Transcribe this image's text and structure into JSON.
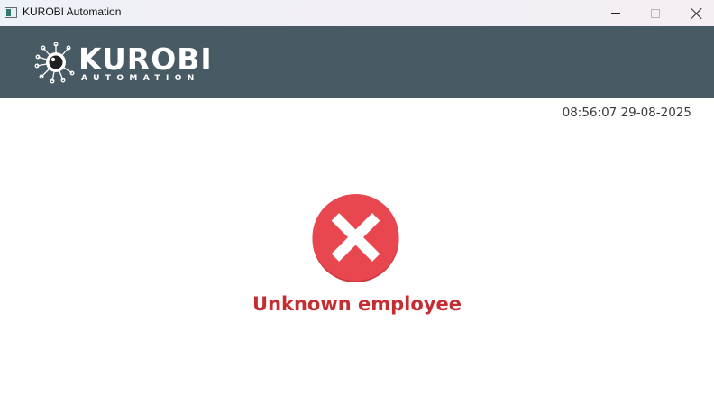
{
  "window": {
    "title": "KUROBI Automation",
    "controls": [
      "minimize",
      "maximize",
      "close"
    ]
  },
  "header": {
    "logo_name": "KUROBI",
    "logo_tagline": "AUTOMATION",
    "logo_icon": "eye-circuit-icon",
    "background_color": "#485a63"
  },
  "clock": {
    "text": "08:56:07 29-08-2025"
  },
  "status": {
    "icon": "error-x-icon",
    "icon_color": "#e8474f",
    "message": "Unknown employee",
    "message_color": "#c62d31"
  }
}
